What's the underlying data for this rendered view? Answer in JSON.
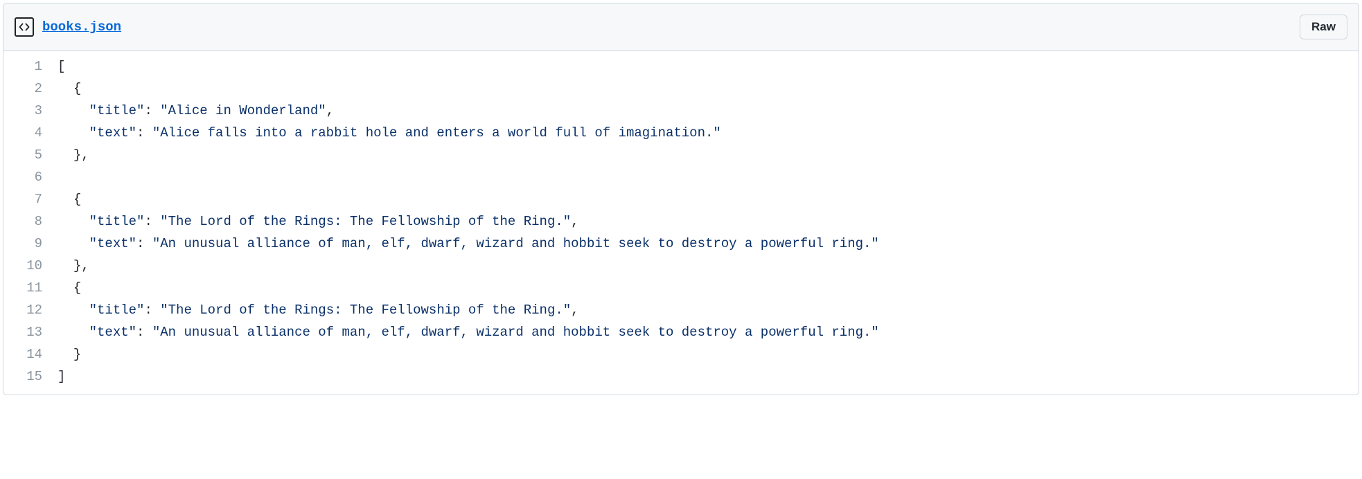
{
  "header": {
    "filename": "books.json",
    "raw_button": "Raw"
  },
  "code": {
    "lines": [
      {
        "n": "1",
        "indent": "",
        "segs": [
          {
            "c": "pn",
            "t": "["
          }
        ]
      },
      {
        "n": "2",
        "indent": "  ",
        "segs": [
          {
            "c": "pn",
            "t": "{"
          }
        ]
      },
      {
        "n": "3",
        "indent": "    ",
        "segs": [
          {
            "c": "ky",
            "t": "\"title\""
          },
          {
            "c": "pn",
            "t": ": "
          },
          {
            "c": "st",
            "t": "\"Alice in Wonderland\""
          },
          {
            "c": "pn",
            "t": ","
          }
        ]
      },
      {
        "n": "4",
        "indent": "    ",
        "segs": [
          {
            "c": "ky",
            "t": "\"text\""
          },
          {
            "c": "pn",
            "t": ": "
          },
          {
            "c": "st",
            "t": "\"Alice falls into a rabbit hole and enters a world full of imagination.\""
          }
        ]
      },
      {
        "n": "5",
        "indent": "  ",
        "segs": [
          {
            "c": "pn",
            "t": "},"
          }
        ]
      },
      {
        "n": "6",
        "indent": "",
        "segs": []
      },
      {
        "n": "7",
        "indent": "  ",
        "segs": [
          {
            "c": "pn",
            "t": "{"
          }
        ]
      },
      {
        "n": "8",
        "indent": "    ",
        "segs": [
          {
            "c": "ky",
            "t": "\"title\""
          },
          {
            "c": "pn",
            "t": ": "
          },
          {
            "c": "st",
            "t": "\"The Lord of the Rings: The Fellowship of the Ring.\""
          },
          {
            "c": "pn",
            "t": ","
          }
        ]
      },
      {
        "n": "9",
        "indent": "    ",
        "segs": [
          {
            "c": "ky",
            "t": "\"text\""
          },
          {
            "c": "pn",
            "t": ": "
          },
          {
            "c": "st",
            "t": "\"An unusual alliance of man, elf, dwarf, wizard and hobbit seek to destroy a powerful ring.\""
          }
        ]
      },
      {
        "n": "10",
        "indent": "  ",
        "segs": [
          {
            "c": "pn",
            "t": "},"
          }
        ]
      },
      {
        "n": "11",
        "indent": "  ",
        "segs": [
          {
            "c": "pn",
            "t": "{"
          }
        ]
      },
      {
        "n": "12",
        "indent": "    ",
        "segs": [
          {
            "c": "ky",
            "t": "\"title\""
          },
          {
            "c": "pn",
            "t": ": "
          },
          {
            "c": "st",
            "t": "\"The Lord of the Rings: The Fellowship of the Ring.\""
          },
          {
            "c": "pn",
            "t": ","
          }
        ]
      },
      {
        "n": "13",
        "indent": "    ",
        "segs": [
          {
            "c": "ky",
            "t": "\"text\""
          },
          {
            "c": "pn",
            "t": ": "
          },
          {
            "c": "st",
            "t": "\"An unusual alliance of man, elf, dwarf, wizard and hobbit seek to destroy a powerful ring.\""
          }
        ]
      },
      {
        "n": "14",
        "indent": "  ",
        "segs": [
          {
            "c": "pn",
            "t": "}"
          }
        ]
      },
      {
        "n": "15",
        "indent": "",
        "segs": [
          {
            "c": "pn",
            "t": "]"
          }
        ]
      }
    ]
  }
}
